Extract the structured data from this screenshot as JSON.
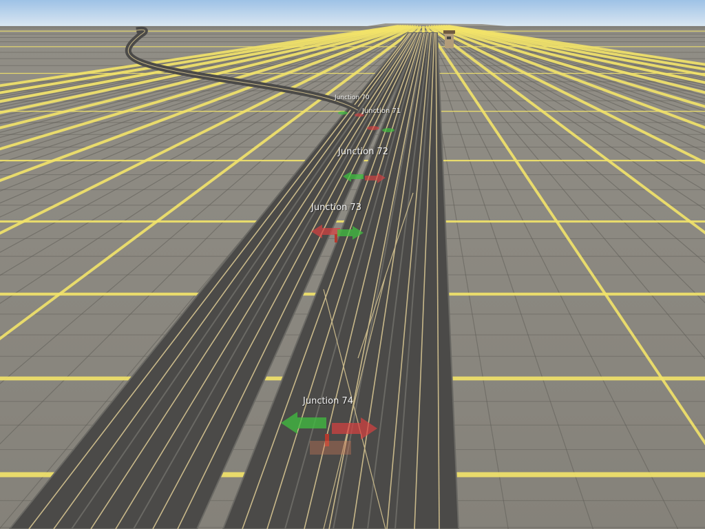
{
  "scene": {
    "colors": {
      "sky_top": "#9ec2e6",
      "sky_horizon": "#d8e6f2",
      "ground": "#8a877f",
      "grid_line": "#5f5d57",
      "major_grid_line": "#f3e46a",
      "ballast": "#4b4a48",
      "ballast_edge": "#6a6964",
      "rail": "#c9b98a",
      "sleeper": "#6b5236",
      "marker_green": "#3fbf3f",
      "marker_red": "#d94040"
    },
    "junctions": [
      {
        "label": "Junction 70"
      },
      {
        "label": "Junction 71"
      },
      {
        "label": "Junction 72"
      },
      {
        "label": "Junction 73"
      },
      {
        "label": "Junction 74"
      }
    ]
  }
}
